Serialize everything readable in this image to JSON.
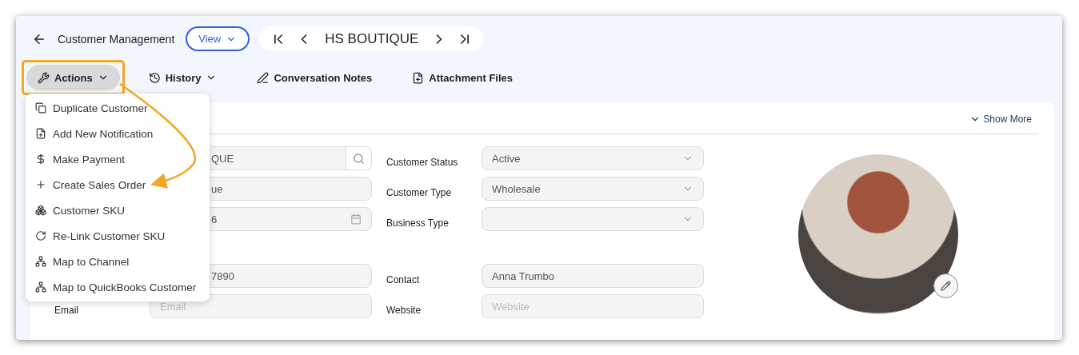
{
  "header": {
    "title": "Customer Management",
    "view_button": "View",
    "record_name": "HS BOUTIQUE"
  },
  "toolbar": [
    {
      "label": "Actions",
      "kind": "dropdown",
      "highlighted": true
    },
    {
      "label": "History",
      "kind": "dropdown",
      "highlighted": false
    },
    {
      "label": "Conversation Notes",
      "kind": "plain",
      "highlighted": false
    },
    {
      "label": "Attachment Files",
      "kind": "plain",
      "highlighted": false
    }
  ],
  "actions_menu": {
    "open": true,
    "items": [
      "Duplicate Customer",
      "Add New Notification",
      "Make Payment",
      "Create Sales Order",
      "Customer SKU",
      "Re-Link Customer SKU",
      "Map to Channel",
      "Map to QuickBooks Customer"
    ]
  },
  "show_more": "Show More",
  "left_column": {
    "groups": [
      [
        {
          "value": "QUE",
          "kind": "search"
        },
        {
          "value": "ue",
          "kind": "text"
        },
        {
          "value": "6",
          "kind": "date"
        }
      ],
      [
        {
          "value": "7890",
          "kind": "text"
        },
        {
          "label": "Email",
          "placeholder": "Email",
          "kind": "text"
        }
      ]
    ]
  },
  "right_column": {
    "groups": [
      [
        {
          "label": "Customer Status",
          "value": "Active",
          "kind": "select"
        },
        {
          "label": "Customer Type",
          "value": "Wholesale",
          "kind": "select"
        },
        {
          "label": "Business Type",
          "kind": "select"
        }
      ],
      [
        {
          "label": "Contact",
          "value": "Anna Trumbo",
          "kind": "text"
        },
        {
          "label": "Website",
          "placeholder": "Website",
          "kind": "text"
        }
      ]
    ]
  }
}
